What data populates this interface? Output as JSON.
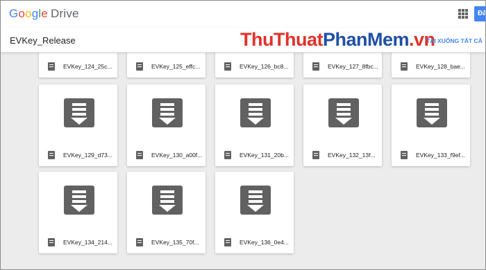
{
  "header": {
    "logo_letters": [
      "G",
      "o",
      "o",
      "g",
      "l",
      "e"
    ],
    "logo_drive": "Drive",
    "apps_icon": "apps-grid-icon",
    "signin_label": "Đă"
  },
  "toolbar": {
    "folder_title": "EVKey_Release",
    "download_all_label": "TẢI XUỐNG TẤT CẢ"
  },
  "watermark": {
    "part1": "ThuThuat",
    "part2": "PhanMem",
    "part3": ".vn"
  },
  "files": [
    {
      "name": "EVKey_124_25c..."
    },
    {
      "name": "EVKey_125_effc..."
    },
    {
      "name": "EVKey_126_bc8..."
    },
    {
      "name": "EVKey_127_8fbc..."
    },
    {
      "name": "EVKey_128_bae..."
    },
    {
      "name": "EVKey_129_d73..."
    },
    {
      "name": "EVKey_130_a00f..."
    },
    {
      "name": "EVKey_131_20b..."
    },
    {
      "name": "EVKey_132_13f..."
    },
    {
      "name": "EVKey_133_f9ef..."
    },
    {
      "name": "EVKey_134_214..."
    },
    {
      "name": "EVKey_135_70f..."
    },
    {
      "name": "EVKey_136_0e4..."
    }
  ],
  "colors": {
    "brand_blue": "#4285f4",
    "icon_gray": "#616161",
    "watermark_red": "#e0322b",
    "watermark_blue": "#1f4fa6"
  }
}
